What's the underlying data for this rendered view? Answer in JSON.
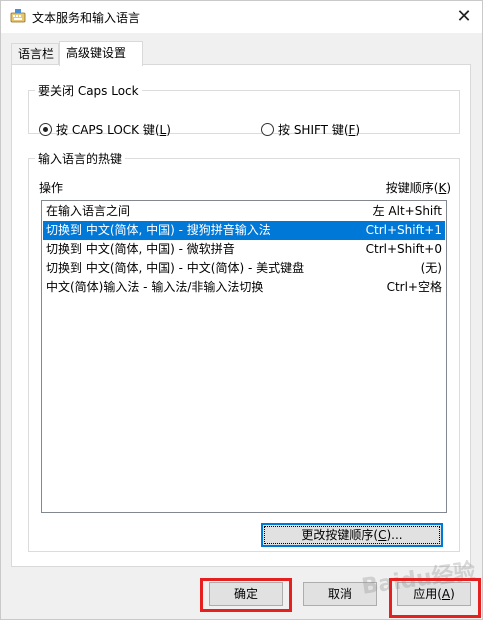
{
  "window": {
    "title": "文本服务和输入语言",
    "close_glyph": "✕",
    "icon": "keyboard-settings-icon"
  },
  "tabs": [
    {
      "label": "语言栏",
      "active": false
    },
    {
      "label": "高级键设置",
      "active": true
    }
  ],
  "capslock": {
    "legend": "要关闭 Caps Lock",
    "options": [
      {
        "label": "按 CAPS LOCK 键(",
        "key": "L",
        "suffix": ")",
        "checked": true
      },
      {
        "label": "按 SHIFT 键(",
        "key": "F",
        "suffix": ")",
        "checked": false
      }
    ]
  },
  "hotkeys": {
    "legend": "输入语言的热键",
    "col_action": "操作",
    "col_sequence_prefix": "按键顺序(",
    "col_sequence_key": "K",
    "col_sequence_suffix": ")",
    "rows": [
      {
        "action": "在输入语言之间",
        "keys": "左 Alt+Shift",
        "selected": false
      },
      {
        "action": "切换到 中文(简体, 中国) - 搜狗拼音输入法",
        "keys": "Ctrl+Shift+1",
        "selected": true
      },
      {
        "action": "切换到 中文(简体, 中国) - 微软拼音",
        "keys": "Ctrl+Shift+0",
        "selected": false
      },
      {
        "action": "切换到 中文(简体, 中国) - 中文(简体) - 美式键盘",
        "keys": "(无)",
        "selected": false
      },
      {
        "action": "中文(简体)输入法 - 输入法/非输入法切换",
        "keys": "Ctrl+空格",
        "selected": false
      }
    ],
    "change_button_prefix": "更改按键顺序(",
    "change_button_key": "C",
    "change_button_suffix": ")..."
  },
  "footer": {
    "ok": "确定",
    "cancel": "取消",
    "apply_prefix": "应用(",
    "apply_key": "A",
    "apply_suffix": ")"
  },
  "watermark": "Baidu经验",
  "colors": {
    "selection": "#0078d7",
    "highlight_box": "#e5201f"
  }
}
